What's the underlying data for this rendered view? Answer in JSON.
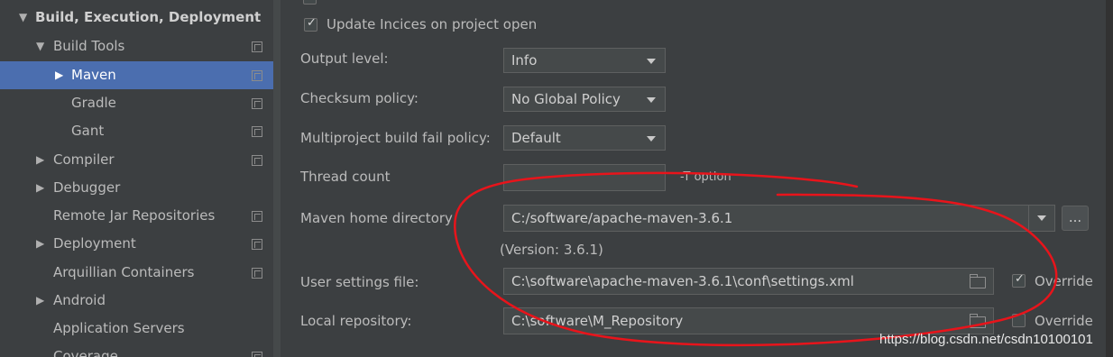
{
  "sidebar": {
    "items": [
      {
        "label": "Build, Execution, Deployment",
        "expanded": true,
        "bold": true
      },
      {
        "label": "Build Tools",
        "expanded": true
      },
      {
        "label": "Maven",
        "expanded": false,
        "selected": true
      },
      {
        "label": "Gradle"
      },
      {
        "label": "Gant"
      },
      {
        "label": "Compiler",
        "expanded": false
      },
      {
        "label": "Debugger",
        "expanded": false
      },
      {
        "label": "Remote Jar Repositories"
      },
      {
        "label": "Deployment",
        "expanded": false
      },
      {
        "label": "Arquillian Containers"
      },
      {
        "label": "Android",
        "expanded": false
      },
      {
        "label": "Application Servers"
      },
      {
        "label": "Coverage"
      }
    ]
  },
  "maven": {
    "update_indices_label": "Update Incices on project open",
    "update_indices_checked": true,
    "output_level_label": "Output level:",
    "output_level_value": "Info",
    "checksum_policy_label": "Checksum policy:",
    "checksum_policy_value": "No Global Policy",
    "fail_policy_label": "Multiproject build fail policy:",
    "fail_policy_value": "Default",
    "thread_count_label": "Thread count",
    "thread_count_value": "",
    "thread_count_hint": "-T option",
    "home_dir_label": "Maven home directory",
    "home_dir_value": "C:/software/apache-maven-3.6.1",
    "home_dir_browse": "...",
    "version_text": "(Version: 3.6.1)",
    "user_settings_label": "User settings file:",
    "user_settings_value": "C:\\software\\apache-maven-3.6.1\\conf\\settings.xml",
    "user_settings_override_label": "Override",
    "user_settings_override_checked": true,
    "local_repo_label": "Local repository:",
    "local_repo_value": "C:\\software\\M_Repository",
    "local_repo_override_label": "Override",
    "local_repo_override_checked": false
  },
  "watermark": "https://blog.csdn.net/csdn10100101",
  "colors": {
    "background": "#3c3f41",
    "selection": "#4b6eaf",
    "annotation": "#e8141b"
  }
}
